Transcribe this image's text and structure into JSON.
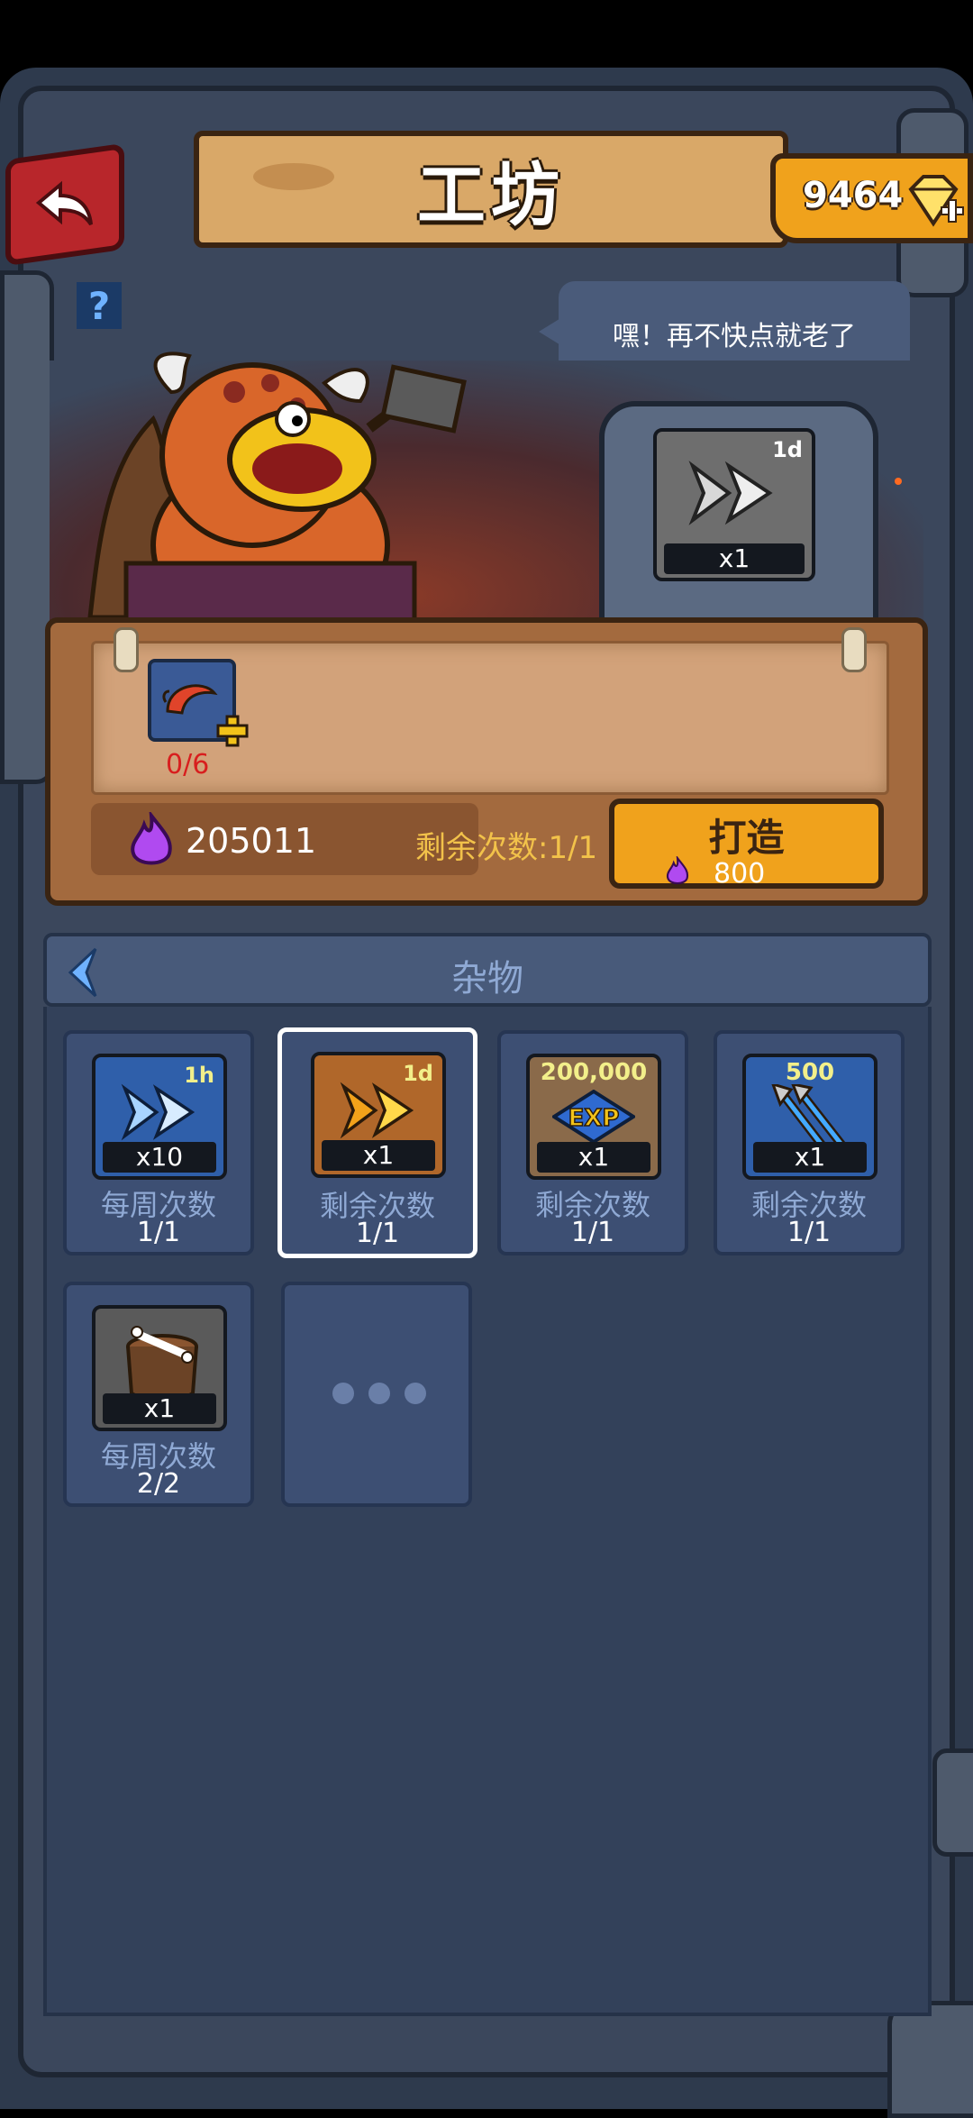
{
  "header": {
    "title": "工坊",
    "gems": "9464"
  },
  "speech": "嘿！再不快点就老了",
  "help_icon": "?",
  "forge_slot": {
    "tag": "1d",
    "qty": "x1"
  },
  "craft": {
    "ingredient_count": "0/6",
    "essence": "205011",
    "remaining": "剩余次数:1/1",
    "button_label": "打造",
    "cost": "800"
  },
  "category": {
    "label": "杂物"
  },
  "items": [
    {
      "tag": "1h",
      "qty": "x10",
      "label": "每周次数",
      "count": "1/1",
      "style": "blue-arrow"
    },
    {
      "tag": "1d",
      "qty": "x1",
      "label": "剩余次数",
      "count": "1/1",
      "style": "gold-arrow"
    },
    {
      "tag": "200,000",
      "qty": "x1",
      "label": "剩余次数",
      "count": "1/1",
      "style": "exp"
    },
    {
      "tag": "500",
      "qty": "x1",
      "label": "剩余次数",
      "count": "1/1",
      "style": "arrows"
    },
    {
      "tag": "",
      "qty": "x1",
      "label": "每周次数",
      "count": "2/2",
      "style": "chest"
    }
  ],
  "colors": {
    "accent": "#f0a21c",
    "panel": "#3d4f73",
    "title_plank": "#d9a868",
    "back": "#b8262b"
  }
}
